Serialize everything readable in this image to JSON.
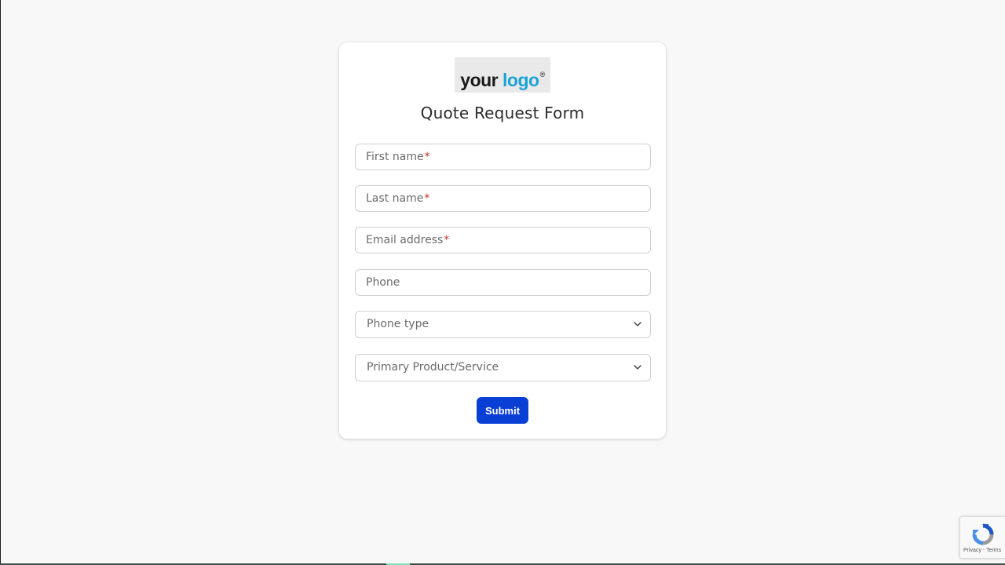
{
  "logo": {
    "word1": "your",
    "word2": "logo",
    "mark": "®"
  },
  "form": {
    "title": "Quote Request Form",
    "fields": [
      {
        "placeholder": "First name",
        "required": true,
        "required_mark": "*"
      },
      {
        "placeholder": "Last name",
        "required": true,
        "required_mark": "*"
      },
      {
        "placeholder": "Email address",
        "required": true,
        "required_mark": "*"
      },
      {
        "placeholder": "Phone",
        "required": false
      }
    ],
    "selects": [
      {
        "placeholder": "Phone type",
        "icon": "chevron-down-icon"
      },
      {
        "placeholder": "Primary Product/Service",
        "icon": "chevron-down-icon"
      }
    ],
    "submit_label": "Submit"
  },
  "recaptcha": {
    "icon": "recaptcha-icon",
    "privacy": "Privacy",
    "separator": " - ",
    "terms": "Terms"
  },
  "colors": {
    "page_bg": "#f8f8f8",
    "accent": "#0a3fd6",
    "logo_blue": "#1aa3d6",
    "required": "#c0392b"
  }
}
